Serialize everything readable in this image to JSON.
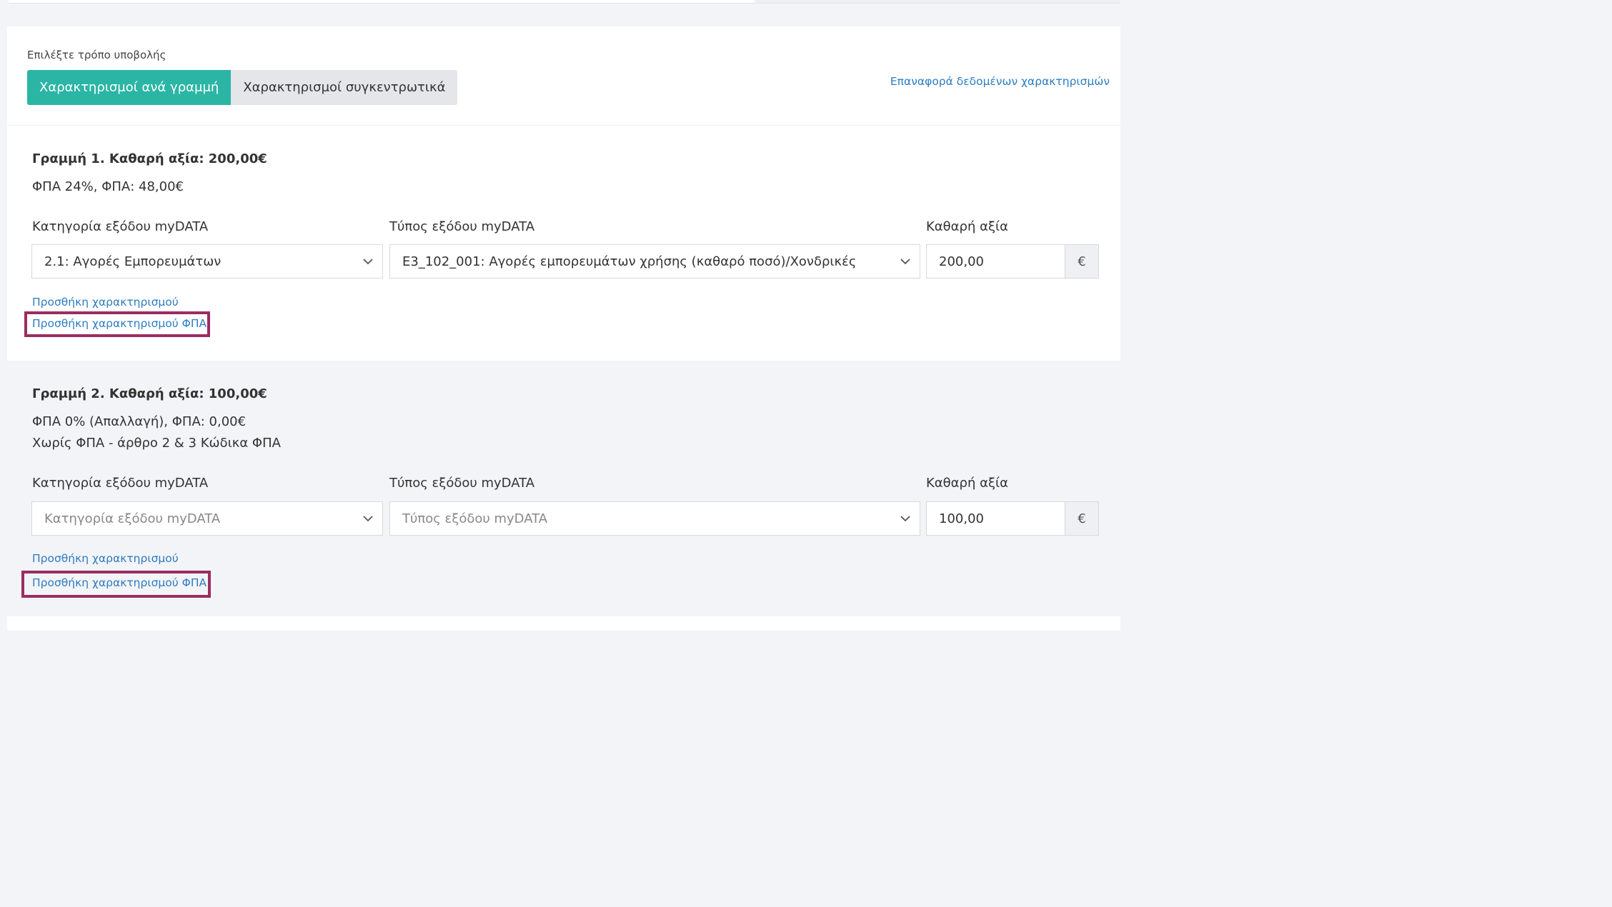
{
  "submission": {
    "mode_label": "Επιλέξτε τρόπο υποβολής",
    "modes": [
      {
        "label": "Χαρακτηρισμοί ανά γραμμή",
        "active": true
      },
      {
        "label": "Χαρακτηρισμοί συγκεντρωτικά",
        "active": false
      }
    ],
    "reset_link": "Επαναφορά δεδομένων χαρακτηρισμών"
  },
  "lines": [
    {
      "title": "Γραμμή 1. Καθαρή αξία: 200,00€",
      "vat_info": [
        "ΦΠΑ 24%, ΦΠΑ: 48,00€"
      ],
      "category_label": "Κατηγορία εξόδου myDATA",
      "category_value": "2.1: Αγορές Εμπορευμάτων",
      "type_label": "Τύπος εξόδου myDATA",
      "type_value": "Ε3_102_001: Αγορές εμπορευμάτων χρήσης (καθαρό ποσό)/Χονδρικές",
      "amount_label": "Καθαρή αξία",
      "amount_value": "200,00",
      "currency": "€",
      "add_characterization": "Προσθήκη χαρακτηρισμού",
      "add_vat_characterization": "Προσθήκη χαρακτηρισμού ΦΠΑ"
    },
    {
      "title": "Γραμμή 2. Καθαρή αξία: 100,00€",
      "vat_info": [
        "ΦΠΑ 0% (Απαλλαγή), ΦΠΑ: 0,00€",
        "Χωρίς ΦΠΑ - άρθρο 2 & 3 Κώδικα ΦΠΑ"
      ],
      "category_label": "Κατηγορία εξόδου myDATA",
      "category_placeholder": "Κατηγορία εξόδου myDATA",
      "type_label": "Τύπος εξόδου myDATA",
      "type_placeholder": "Τύπος εξόδου myDATA",
      "amount_label": "Καθαρή αξία",
      "amount_value": "100,00",
      "currency": "€",
      "add_characterization": "Προσθήκη χαρακτηρισμού",
      "add_vat_characterization": "Προσθήκη χαρακτηρισμού ΦΠΑ"
    }
  ],
  "colors": {
    "accent": "#2bb5a5",
    "link": "#2d7cc2",
    "highlight": "#9b2d62",
    "page_bg": "#f3f4f7"
  },
  "icons": {
    "dropdown": "chevron-down-icon"
  }
}
